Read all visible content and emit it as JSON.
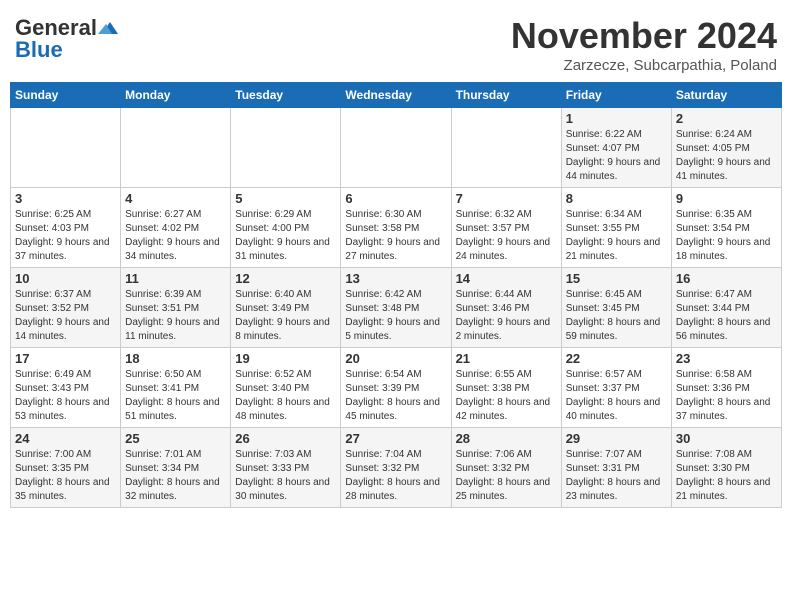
{
  "logo": {
    "text_general": "General",
    "text_blue": "Blue"
  },
  "header": {
    "month_title": "November 2024",
    "location": "Zarzecze, Subcarpathia, Poland"
  },
  "days_of_week": [
    "Sunday",
    "Monday",
    "Tuesday",
    "Wednesday",
    "Thursday",
    "Friday",
    "Saturday"
  ],
  "weeks": [
    [
      {
        "day": "",
        "info": ""
      },
      {
        "day": "",
        "info": ""
      },
      {
        "day": "",
        "info": ""
      },
      {
        "day": "",
        "info": ""
      },
      {
        "day": "",
        "info": ""
      },
      {
        "day": "1",
        "info": "Sunrise: 6:22 AM\nSunset: 4:07 PM\nDaylight: 9 hours and 44 minutes."
      },
      {
        "day": "2",
        "info": "Sunrise: 6:24 AM\nSunset: 4:05 PM\nDaylight: 9 hours and 41 minutes."
      }
    ],
    [
      {
        "day": "3",
        "info": "Sunrise: 6:25 AM\nSunset: 4:03 PM\nDaylight: 9 hours and 37 minutes."
      },
      {
        "day": "4",
        "info": "Sunrise: 6:27 AM\nSunset: 4:02 PM\nDaylight: 9 hours and 34 minutes."
      },
      {
        "day": "5",
        "info": "Sunrise: 6:29 AM\nSunset: 4:00 PM\nDaylight: 9 hours and 31 minutes."
      },
      {
        "day": "6",
        "info": "Sunrise: 6:30 AM\nSunset: 3:58 PM\nDaylight: 9 hours and 27 minutes."
      },
      {
        "day": "7",
        "info": "Sunrise: 6:32 AM\nSunset: 3:57 PM\nDaylight: 9 hours and 24 minutes."
      },
      {
        "day": "8",
        "info": "Sunrise: 6:34 AM\nSunset: 3:55 PM\nDaylight: 9 hours and 21 minutes."
      },
      {
        "day": "9",
        "info": "Sunrise: 6:35 AM\nSunset: 3:54 PM\nDaylight: 9 hours and 18 minutes."
      }
    ],
    [
      {
        "day": "10",
        "info": "Sunrise: 6:37 AM\nSunset: 3:52 PM\nDaylight: 9 hours and 14 minutes."
      },
      {
        "day": "11",
        "info": "Sunrise: 6:39 AM\nSunset: 3:51 PM\nDaylight: 9 hours and 11 minutes."
      },
      {
        "day": "12",
        "info": "Sunrise: 6:40 AM\nSunset: 3:49 PM\nDaylight: 9 hours and 8 minutes."
      },
      {
        "day": "13",
        "info": "Sunrise: 6:42 AM\nSunset: 3:48 PM\nDaylight: 9 hours and 5 minutes."
      },
      {
        "day": "14",
        "info": "Sunrise: 6:44 AM\nSunset: 3:46 PM\nDaylight: 9 hours and 2 minutes."
      },
      {
        "day": "15",
        "info": "Sunrise: 6:45 AM\nSunset: 3:45 PM\nDaylight: 8 hours and 59 minutes."
      },
      {
        "day": "16",
        "info": "Sunrise: 6:47 AM\nSunset: 3:44 PM\nDaylight: 8 hours and 56 minutes."
      }
    ],
    [
      {
        "day": "17",
        "info": "Sunrise: 6:49 AM\nSunset: 3:43 PM\nDaylight: 8 hours and 53 minutes."
      },
      {
        "day": "18",
        "info": "Sunrise: 6:50 AM\nSunset: 3:41 PM\nDaylight: 8 hours and 51 minutes."
      },
      {
        "day": "19",
        "info": "Sunrise: 6:52 AM\nSunset: 3:40 PM\nDaylight: 8 hours and 48 minutes."
      },
      {
        "day": "20",
        "info": "Sunrise: 6:54 AM\nSunset: 3:39 PM\nDaylight: 8 hours and 45 minutes."
      },
      {
        "day": "21",
        "info": "Sunrise: 6:55 AM\nSunset: 3:38 PM\nDaylight: 8 hours and 42 minutes."
      },
      {
        "day": "22",
        "info": "Sunrise: 6:57 AM\nSunset: 3:37 PM\nDaylight: 8 hours and 40 minutes."
      },
      {
        "day": "23",
        "info": "Sunrise: 6:58 AM\nSunset: 3:36 PM\nDaylight: 8 hours and 37 minutes."
      }
    ],
    [
      {
        "day": "24",
        "info": "Sunrise: 7:00 AM\nSunset: 3:35 PM\nDaylight: 8 hours and 35 minutes."
      },
      {
        "day": "25",
        "info": "Sunrise: 7:01 AM\nSunset: 3:34 PM\nDaylight: 8 hours and 32 minutes."
      },
      {
        "day": "26",
        "info": "Sunrise: 7:03 AM\nSunset: 3:33 PM\nDaylight: 8 hours and 30 minutes."
      },
      {
        "day": "27",
        "info": "Sunrise: 7:04 AM\nSunset: 3:32 PM\nDaylight: 8 hours and 28 minutes."
      },
      {
        "day": "28",
        "info": "Sunrise: 7:06 AM\nSunset: 3:32 PM\nDaylight: 8 hours and 25 minutes."
      },
      {
        "day": "29",
        "info": "Sunrise: 7:07 AM\nSunset: 3:31 PM\nDaylight: 8 hours and 23 minutes."
      },
      {
        "day": "30",
        "info": "Sunrise: 7:08 AM\nSunset: 3:30 PM\nDaylight: 8 hours and 21 minutes."
      }
    ]
  ]
}
